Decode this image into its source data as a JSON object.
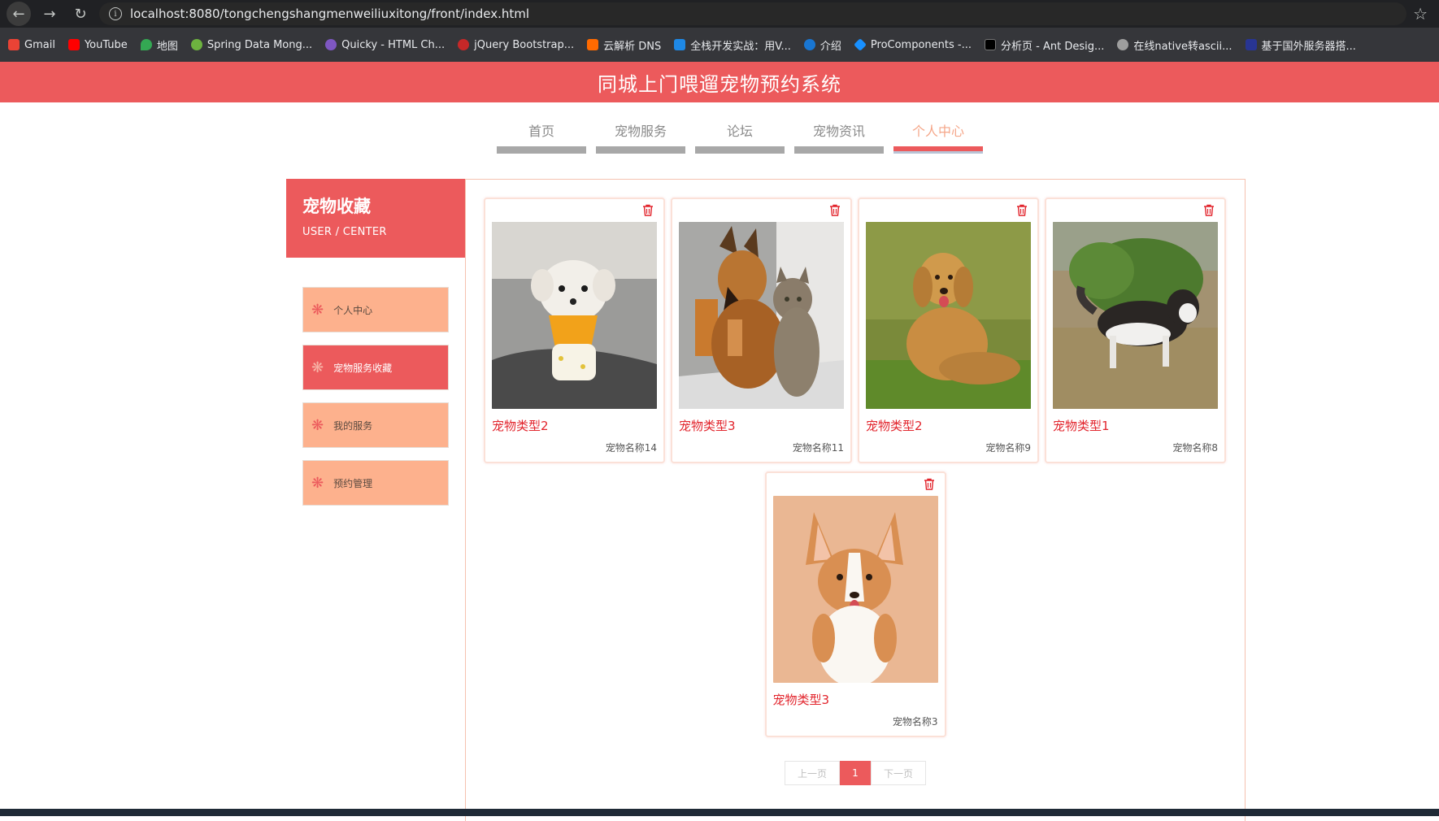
{
  "browser": {
    "url": "localhost:8080/tongchengshangmenweiliuxitong/front/index.html",
    "bookmarks": [
      {
        "label": "Gmail",
        "color": "#ea4335"
      },
      {
        "label": "YouTube",
        "color": "#ff0000"
      },
      {
        "label": "地图",
        "color": "#34a853"
      },
      {
        "label": "Spring Data Mong...",
        "color": "#6db33f"
      },
      {
        "label": "Quicky - HTML Ch...",
        "color": "#7e57c2"
      },
      {
        "label": "jQuery Bootstrap...",
        "color": "#c62828"
      },
      {
        "label": "云解析 DNS",
        "color": "#ff6a00"
      },
      {
        "label": "全栈开发实战：用V...",
        "color": "#1e88e5"
      },
      {
        "label": "介绍",
        "color": "#1976d2"
      },
      {
        "label": "ProComponents -...",
        "color": "#1890ff"
      },
      {
        "label": "分析页 - Ant Desig...",
        "color": "#000000"
      },
      {
        "label": "在线native转ascii...",
        "color": "#9e9e9e"
      },
      {
        "label": "基于国外服务器搭...",
        "color": "#283593"
      }
    ]
  },
  "site": {
    "title": "同城上门喂遛宠物预约系统"
  },
  "topnav": {
    "items": [
      "首页",
      "宠物服务",
      "论坛",
      "宠物资讯",
      "个人中心"
    ],
    "active": "个人中心"
  },
  "sidebar": {
    "title": "宠物收藏",
    "subtitle": "USER / CENTER",
    "items": [
      "个人中心",
      "宠物服务收藏",
      "我的服务",
      "预约管理"
    ],
    "active": "宠物服务收藏"
  },
  "cards": [
    {
      "type": "宠物类型2",
      "name": "宠物名称14",
      "image": "white-puppy-photo"
    },
    {
      "type": "宠物类型3",
      "name": "宠物名称11",
      "image": "shepherd-and-cat-photo"
    },
    {
      "type": "宠物类型2",
      "name": "宠物名称9",
      "image": "golden-retriever-photo"
    },
    {
      "type": "宠物类型1",
      "name": "宠物名称8",
      "image": "husky-photo"
    },
    {
      "type": "宠物类型3",
      "name": "宠物名称3",
      "image": "corgi-photo"
    }
  ],
  "pagination": {
    "prev": "上一页",
    "current": "1",
    "next": "下一页"
  },
  "colors": {
    "brand": "#ec5a5c",
    "menu": "#fdb18d",
    "accent_text": "#e2242c"
  }
}
